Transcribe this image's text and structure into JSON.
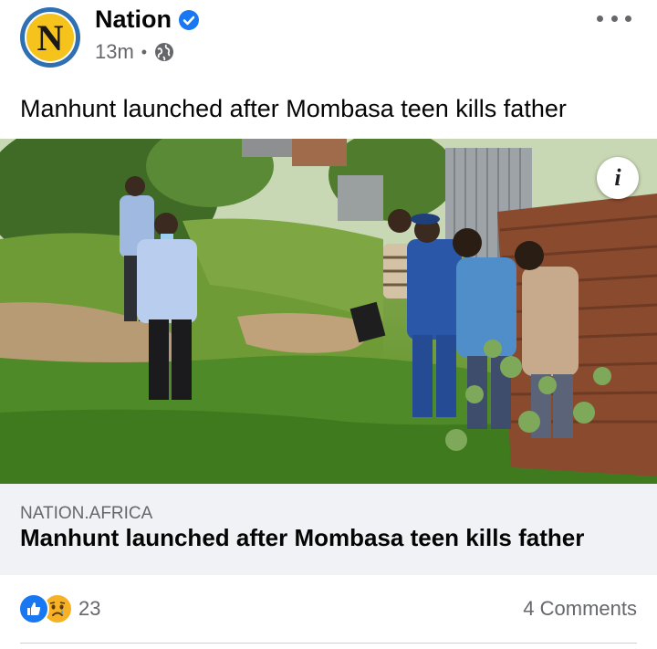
{
  "post": {
    "page_name": "Nation",
    "avatar_letter": "N",
    "timestamp": "13m",
    "audience_icon": "globe-icon",
    "verified_icon": "verified-badge-icon",
    "menu_icon": "more-options-icon",
    "text": "Manhunt launched after Mombasa teen kills father"
  },
  "photo": {
    "info_label": "i"
  },
  "link_preview": {
    "domain": "NATION.AFRICA",
    "title": "Manhunt launched after Mombasa teen kills father"
  },
  "engagement": {
    "reactions": [
      "like",
      "sad"
    ],
    "reaction_count": "23",
    "comments": "4 Comments"
  },
  "colors": {
    "brand_blue": "#1877f2",
    "secondary_text": "#65676b",
    "card_background": "#f0f2f5",
    "avatar_ring": "#2f6fb3",
    "avatar_fill": "#f6c21c"
  }
}
